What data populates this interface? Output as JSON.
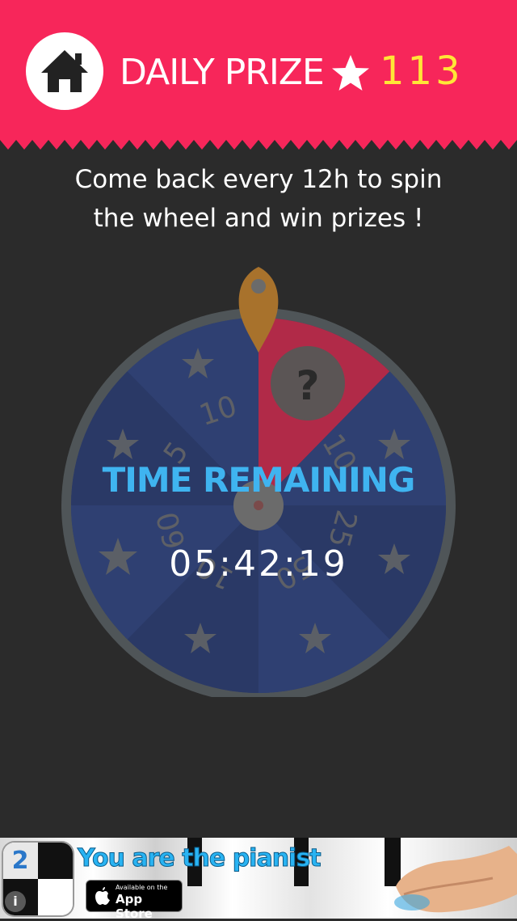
{
  "header": {
    "title": "DAILY PRIZE",
    "score": "113",
    "home_icon": "home-icon",
    "star_icon": "star-icon",
    "background_color": "#f7265a",
    "score_color": "#ffe637"
  },
  "message": {
    "line1": "Come back every 12h to spin",
    "line2": "the wheel and win prizes !"
  },
  "wheel": {
    "segments": [
      "?",
      "10",
      "25",
      "50",
      "10",
      "60",
      "5",
      "10"
    ],
    "pointer_icon": "pointer-icon",
    "mystery_icon": "question-icon"
  },
  "timer": {
    "label": "TIME REMAINING",
    "value": "05:42:19",
    "label_color": "#3fb4f0"
  },
  "ad": {
    "headline": "You are the pianist",
    "icon_number": "2",
    "badge_small": "Available on the",
    "badge_big": "App Store",
    "info_icon": "info-icon"
  }
}
